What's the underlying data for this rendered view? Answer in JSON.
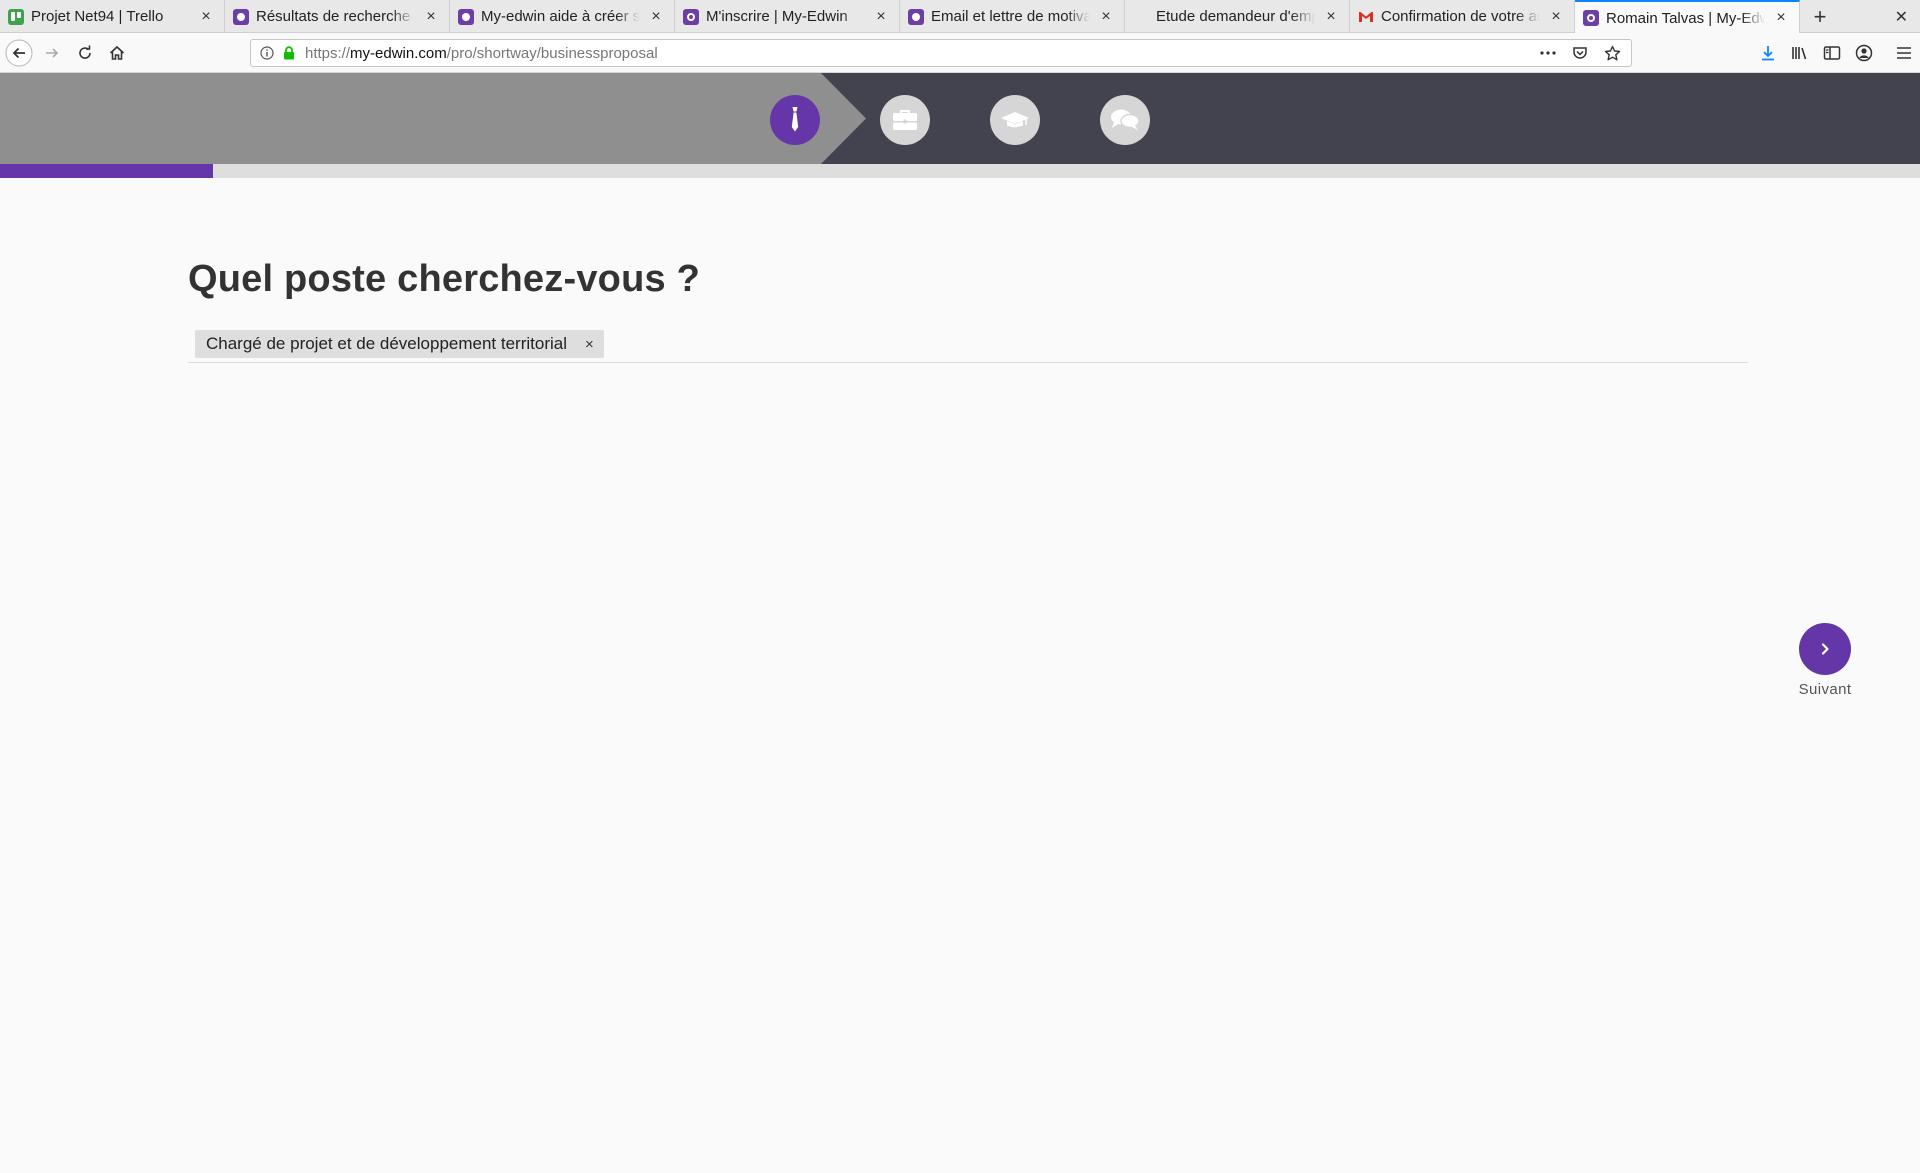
{
  "browser": {
    "tabs": [
      {
        "title": "Projet Net94 | Trello",
        "favicon": "trello-icon",
        "active": false
      },
      {
        "title": "Résultats de recherche | My-Edwin",
        "favicon": "edwin-icon",
        "active": false
      },
      {
        "title": "My-edwin aide à créer son CV",
        "favicon": "edwin-icon",
        "active": false
      },
      {
        "title": "M'inscrire | My-Edwin",
        "favicon": "edwin-round-icon",
        "active": false
      },
      {
        "title": "Email et lettre de motivation",
        "favicon": "edwin-icon",
        "active": false
      },
      {
        "title": "Etude demandeur d'emploi et",
        "favicon": "none",
        "active": false
      },
      {
        "title": "Confirmation de votre adresse",
        "favicon": "gmail-icon",
        "active": false
      },
      {
        "title": "Romain Talvas | My-Edwin",
        "favicon": "edwin-round-icon",
        "active": true
      }
    ],
    "url": {
      "protocol": "https://",
      "host": "my-edwin.com",
      "path": "/pro/shortway/businessproposal"
    }
  },
  "stepper": {
    "steps": [
      {
        "icon": "tie-icon",
        "active": true
      },
      {
        "icon": "briefcase-icon",
        "active": false
      },
      {
        "icon": "graduation-cap-icon",
        "active": false
      },
      {
        "icon": "speech-bubbles-icon",
        "active": false
      }
    ],
    "progress_fraction": 0.111
  },
  "main": {
    "question": "Quel poste cherchez-vous ?",
    "tags": [
      {
        "label": "Chargé de projet et de développement territorial",
        "remove": "×"
      }
    ]
  },
  "next_button": {
    "label": "Suivant"
  },
  "colors": {
    "accent": "#6536a7",
    "header_dark": "#43424f",
    "header_light": "#8f8f8f"
  }
}
